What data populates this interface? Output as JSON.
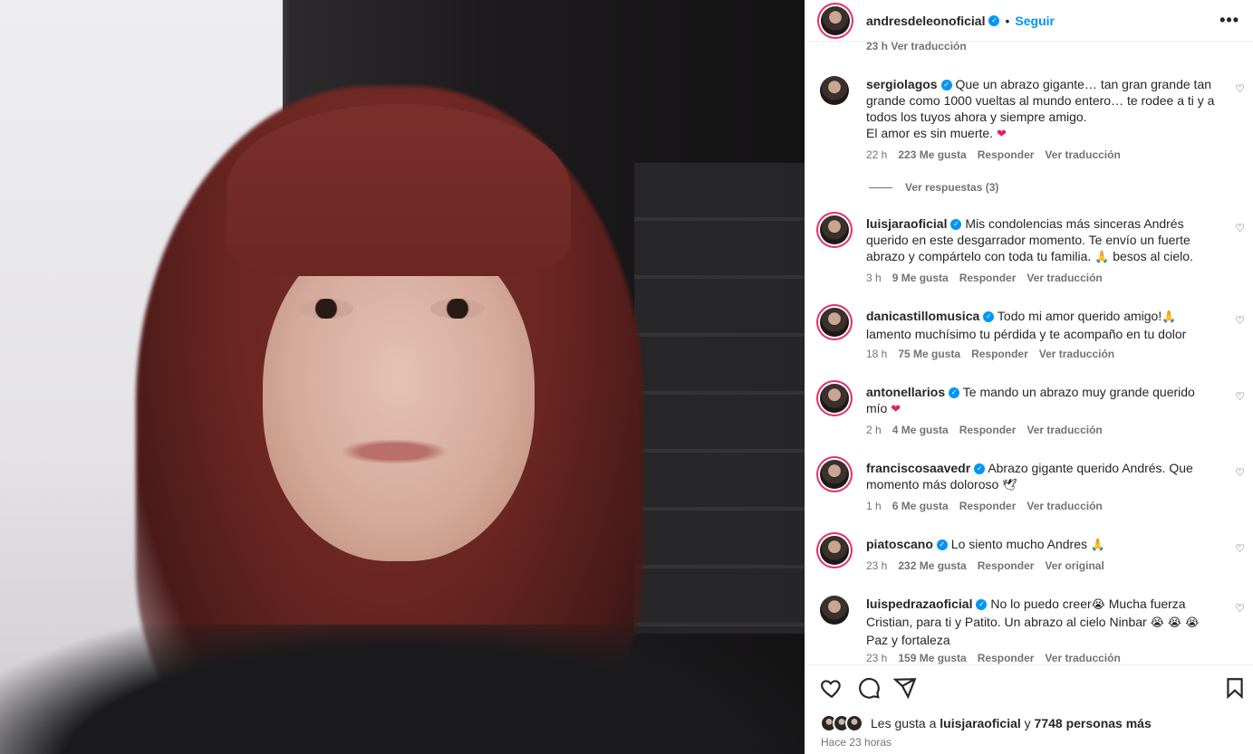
{
  "post": {
    "author": "andresdeleonoficial",
    "follow_label": "Seguir",
    "dot": "•",
    "more_label": "•••"
  },
  "stub": "23 h   Ver traducción",
  "comments": [
    {
      "user": "sergiolagos",
      "text": "Que un abrazo gigante… tan gran grande tan grande como 1000 vueltas al mundo entero… te rodee a ti y a todos los tuyos ahora y siempre amigo.",
      "text2": "El amor es sin muerte.",
      "emoji": "❤",
      "time": "22 h",
      "likes": "223 Me gusta",
      "reply": "Responder",
      "translate": "Ver traducción",
      "replies": "Ver respuestas (3)"
    },
    {
      "user": "luisjaraoficial",
      "text": "Mis condolencias más sinceras Andrés querido en este desgarrador momento. Te envío un fuerte abrazo y compártelo con toda tu familia.",
      "emoji": "🙏",
      "text_after": "besos al cielo.",
      "time": "3 h",
      "likes": "9 Me gusta",
      "reply": "Responder",
      "translate": "Ver traducción"
    },
    {
      "user": "danicastillomusica",
      "text": "Todo mi amor querido amigo!",
      "emoji": "🙏",
      "text_after": "lamento muchísimo tu pérdida y te acompaño en tu dolor",
      "time": "18 h",
      "likes": "75 Me gusta",
      "reply": "Responder",
      "translate": "Ver traducción"
    },
    {
      "user": "antonellarios",
      "text": "Te mando un abrazo muy grande querido mío",
      "emoji": "❤",
      "time": "2 h",
      "likes": "4 Me gusta",
      "reply": "Responder",
      "translate": "Ver traducción"
    },
    {
      "user": "franciscosaavedr",
      "text": "Abrazo gigante querido Andrés. Que momento más doloroso",
      "emoji": "🕊",
      "time": "1 h",
      "likes": "6 Me gusta",
      "reply": "Responder",
      "translate": "Ver traducción"
    },
    {
      "user": "piatoscano",
      "text": "Lo siento mucho Andres",
      "emoji": "🙏",
      "time": "23 h",
      "likes": "232 Me gusta",
      "reply": "Responder",
      "translate": "Ver original"
    },
    {
      "user": "luispedrazaoficial",
      "text": "No lo puedo creer",
      "emoji": "😭",
      "text_after": "Mucha fuerza Cristian, para ti y Patito. Un abrazo al cielo Ninbar",
      "emoji2": "😭 😭 😭",
      "text_end": "Paz y fortaleza",
      "time": "23 h",
      "likes": "159 Me gusta",
      "reply": "Responder",
      "translate": "Ver traducción"
    }
  ],
  "footer": {
    "likes_prefix": "Les gusta a",
    "likes_user": "luisjaraoficial",
    "likes_and": "y",
    "likes_count": "7748 personas más",
    "time": "Hace 23 horas"
  },
  "icons": [
    "heart-icon",
    "comment-icon",
    "share-icon",
    "bookmark-icon",
    "verified-icon",
    "more-icon"
  ]
}
